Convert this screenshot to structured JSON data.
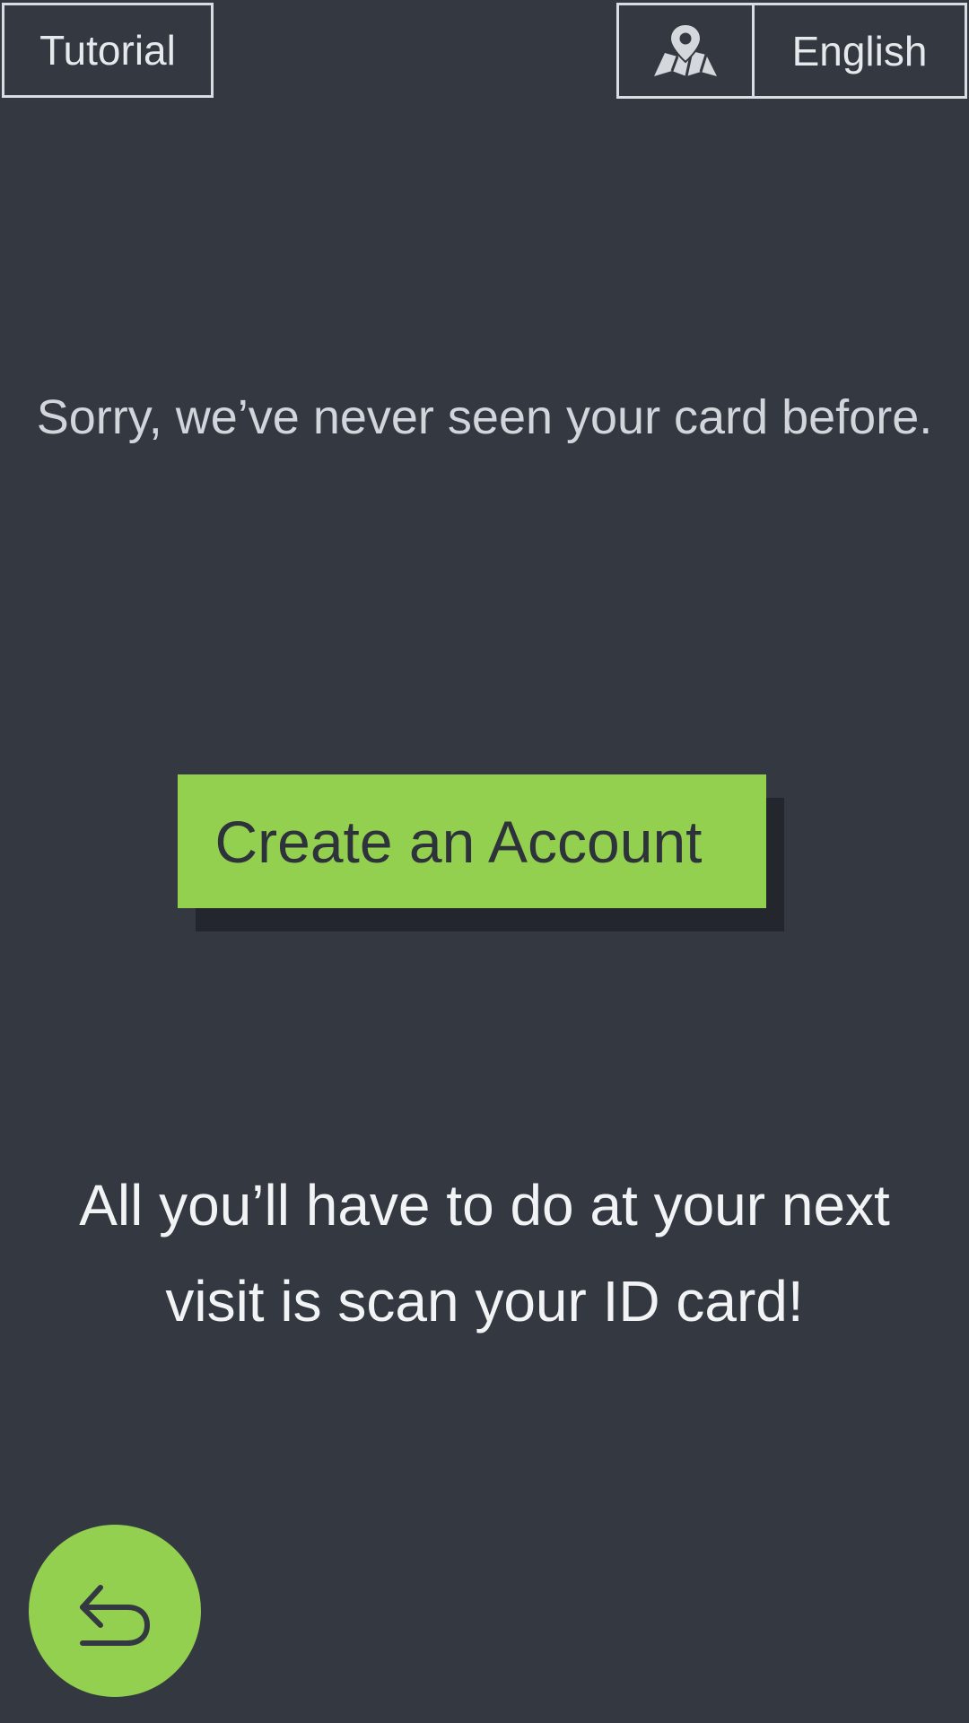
{
  "header": {
    "tutorial_label": "Tutorial",
    "language_label": "English",
    "map_icon": "map-pin-icon"
  },
  "main": {
    "message": "Sorry, we’ve never seen your card before.",
    "create_account_label": "Create an Account",
    "info_line_1": "All you’ll have to do at your next",
    "info_line_2": "visit is scan your ID card!"
  },
  "footer": {
    "back_icon": "back-arrow-icon"
  },
  "colors": {
    "background": "#333841",
    "accent": "#94d04f",
    "border": "#d9dde2",
    "text_light": "#f2f3f5"
  }
}
